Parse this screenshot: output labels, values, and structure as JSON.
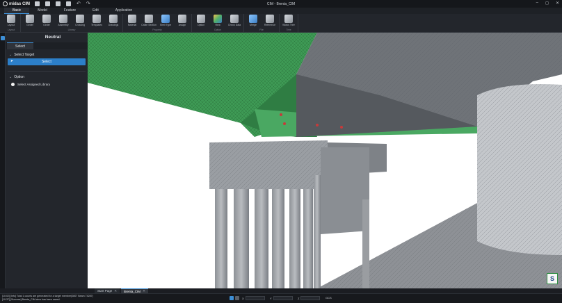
{
  "app": {
    "name": "midas CIM",
    "window_title": "CIM - Brenta_CIM"
  },
  "menu": {
    "tabs": [
      "Basic",
      "Model",
      "Feature",
      "Edit",
      "Application"
    ],
    "active": "Basic"
  },
  "ribbon": {
    "groups": [
      {
        "name": "Layout",
        "items": [
          {
            "label": "Layout",
            "icon": "layout-icon",
            "style": "gray"
          }
        ]
      },
      {
        "name": "Library",
        "items": [
          {
            "label": "Girder",
            "icon": "girder-icon",
            "style": "gray"
          },
          {
            "label": "Girder",
            "icon": "girder-icon",
            "style": "gray"
          },
          {
            "label": "Assembly",
            "icon": "assembly-icon",
            "style": "gray"
          },
          {
            "label": "Crossing",
            "icon": "crossing-icon",
            "style": "gray"
          },
          {
            "label": "Templates",
            "icon": "templates-icon",
            "style": "gray"
          },
          {
            "label": "Drawings",
            "icon": "drawings-icon",
            "style": "gray"
          }
        ]
      },
      {
        "name": "Property",
        "items": [
          {
            "label": "Material",
            "icon": "material-icon",
            "style": "gray"
          },
          {
            "label": "Cable Section",
            "icon": "cable-section-icon",
            "style": "gray"
          },
          {
            "label": "Shell Type",
            "icon": "shell-type-icon",
            "style": "blue"
          },
          {
            "label": "Assign",
            "icon": "assign-icon",
            "style": "gray"
          }
        ]
      },
      {
        "name": "Option",
        "items": [
          {
            "label": "Option",
            "icon": "gear-icon",
            "style": "gray"
          },
          {
            "label": "View",
            "icon": "view-icon",
            "style": "color"
          },
          {
            "label": "Check Data",
            "icon": "check-data-icon",
            "style": "gray"
          }
        ]
      },
      {
        "name": "File",
        "items": [
          {
            "label": "Merge",
            "icon": "merge-icon",
            "style": "blue"
          },
          {
            "label": "Reference",
            "icon": "reference-icon",
            "style": "gray"
          }
        ]
      },
      {
        "name": "Tree",
        "items": [
          {
            "label": "Works Tree",
            "icon": "works-tree-icon",
            "style": "gray"
          }
        ]
      }
    ]
  },
  "panel": {
    "title": "Neutral",
    "tab": "Select",
    "select_target": {
      "header": "Select Target",
      "button": "Select"
    },
    "option": {
      "header": "Option",
      "radio_label": "Select Assigned Library"
    }
  },
  "doc_tabs": [
    {
      "label": "Start Page",
      "active": false
    },
    {
      "label": "Brenta_CIM",
      "active": true
    }
  ],
  "status": {
    "log": [
      "[10:02] [Info] Total 1 counts are generated for a target member(0807 Beam 74287)",
      "[10:37] [Success] Brenta_CIM.cimx has been saved."
    ],
    "coords": [
      {
        "label": "X"
      },
      {
        "label": "Y"
      },
      {
        "label": "Z"
      }
    ],
    "unit": "GCS"
  },
  "viewport": {
    "badge": "S"
  }
}
